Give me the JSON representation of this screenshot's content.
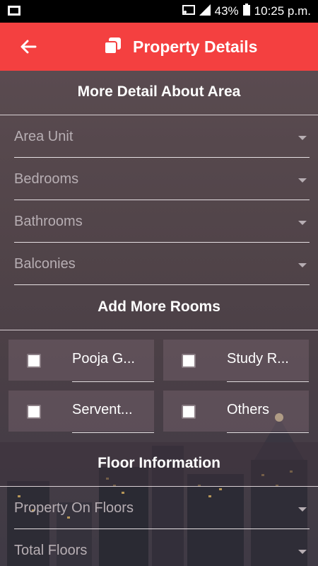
{
  "status_bar": {
    "battery": "43%",
    "time": "10:25 p.m."
  },
  "app_bar": {
    "title": "Property Details"
  },
  "sections": {
    "area_title": "More Detail About Area",
    "rooms_title": "Add More Rooms",
    "floor_title": "Floor Information"
  },
  "dropdowns": {
    "area_unit": "Area Unit",
    "bedrooms": "Bedrooms",
    "bathrooms": "Bathrooms",
    "balconies": "Balconies",
    "property_on_floors": "Property On Floors",
    "total_floors": "Total Floors"
  },
  "rooms": [
    {
      "label": "Pooja G...",
      "checked": false
    },
    {
      "label": "Study R...",
      "checked": false
    },
    {
      "label": "Servent...",
      "checked": false
    },
    {
      "label": "Others",
      "checked": false
    }
  ],
  "colors": {
    "app_bar": "#f44040",
    "status_bar": "#000000"
  }
}
